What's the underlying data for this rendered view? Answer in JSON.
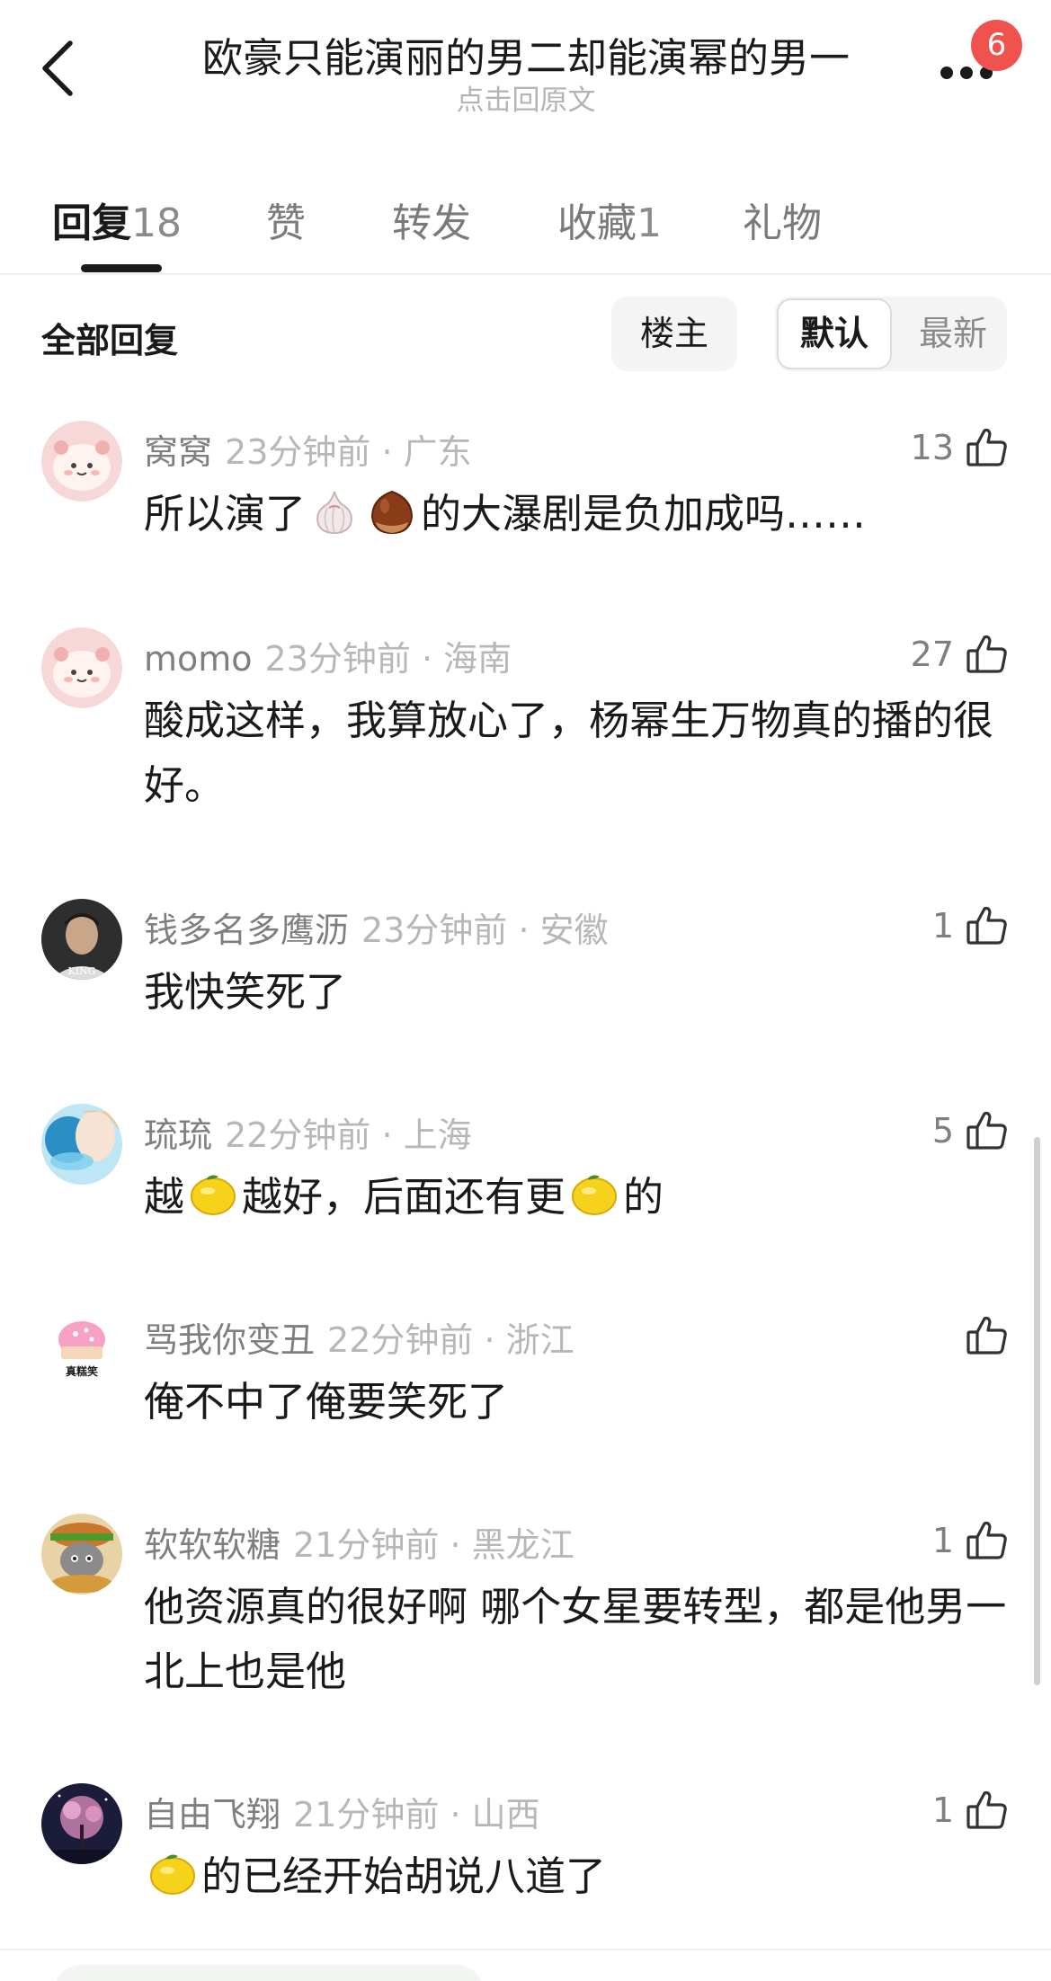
{
  "header": {
    "title": "欧豪只能演丽的男二却能演幂的男一",
    "subtitle": "点击回原文",
    "notification_count": "6"
  },
  "tabs": [
    {
      "label": "回复",
      "count": "18"
    },
    {
      "label": "赞",
      "count": ""
    },
    {
      "label": "转发",
      "count": ""
    },
    {
      "label": "收藏",
      "count": "1"
    },
    {
      "label": "礼物",
      "count": ""
    }
  ],
  "filter": {
    "label": "全部回复",
    "op_button": "楼主",
    "sort_default": "默认",
    "sort_newest": "最新"
  },
  "comments": [
    {
      "name": "窝窝",
      "time": "23分钟前 · 广东",
      "likes": "13",
      "text_parts": [
        "所以演了",
        "",
        "的大瀑剧是负加成吗……"
      ],
      "emojis": [
        "garlic-icon",
        "chestnut-icon"
      ]
    },
    {
      "name": "momo",
      "time": "23分钟前 · 海南",
      "likes": "27",
      "text": "酸成这样，我算放心了，杨幂生万物真的播的很好。"
    },
    {
      "name": "钱多名多鹰沥",
      "time": "23分钟前 · 安徽",
      "likes": "1",
      "text": "我快笑死了"
    },
    {
      "name": "琉琉",
      "time": "22分钟前 · 上海",
      "likes": "5",
      "text_parts": [
        "越",
        "越好，后面还有更",
        "的"
      ],
      "emojis": [
        "lemon-icon",
        "lemon-icon"
      ]
    },
    {
      "name": "骂我你变丑",
      "time": "22分钟前 · 浙江",
      "likes": "",
      "text": "俺不中了俺要笑死了"
    },
    {
      "name": "软软软糖",
      "time": "21分钟前 · 黑龙江",
      "likes": "1",
      "text": "他资源真的很好啊 哪个女星要转型，都是他男一 北上也是他"
    },
    {
      "name": "自由飞翔",
      "time": "21分钟前 · 山西",
      "likes": "1",
      "text_parts": [
        "的已经开始胡说八道了"
      ],
      "emojis": [
        "lemon-icon"
      ]
    }
  ],
  "avatar_text": {
    "king": "KING",
    "cake": "真糕笑"
  },
  "colors": {
    "accent_badge": "#f0534e",
    "secondary_text": "#7f7f7f",
    "time_text": "#b7b7b7"
  }
}
